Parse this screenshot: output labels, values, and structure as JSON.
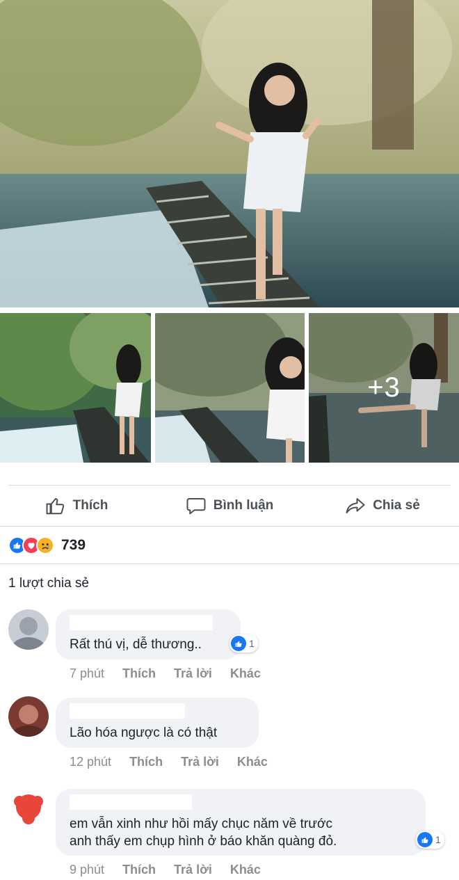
{
  "post": {
    "more_photos_label": "+3"
  },
  "actions": {
    "like_label": "Thích",
    "comment_label": "Bình luận",
    "share_label": "Chia sẻ"
  },
  "reactions": {
    "count": "739",
    "icons": [
      "like-icon",
      "love-icon",
      "sad-icon"
    ]
  },
  "shares": {
    "label": "1 lượt chia sẻ"
  },
  "comments": [
    {
      "text": "Rất thú vị, dễ thương..",
      "likes": "1",
      "time": "7 phút",
      "like": "Thích",
      "reply": "Trả lời",
      "more": "Khác"
    },
    {
      "text": "Lão hóa ngược là có thật",
      "time": "12 phút",
      "like": "Thích",
      "reply": "Trả lời",
      "more": "Khác"
    },
    {
      "text": "em vẫn xinh như hồi mấy chục năm về trước\nanh thấy em chụp hình ở báo khăn quàng đỏ.",
      "likes": "1",
      "time": "9 phút",
      "like": "Thích",
      "reply": "Trả lời",
      "more": "Khác"
    }
  ],
  "colors": {
    "accent": "#1877f2",
    "love": "#f33e58",
    "sad": "#f7b125",
    "bubble": "#f0f2f5",
    "meta": "#8a8d91"
  }
}
